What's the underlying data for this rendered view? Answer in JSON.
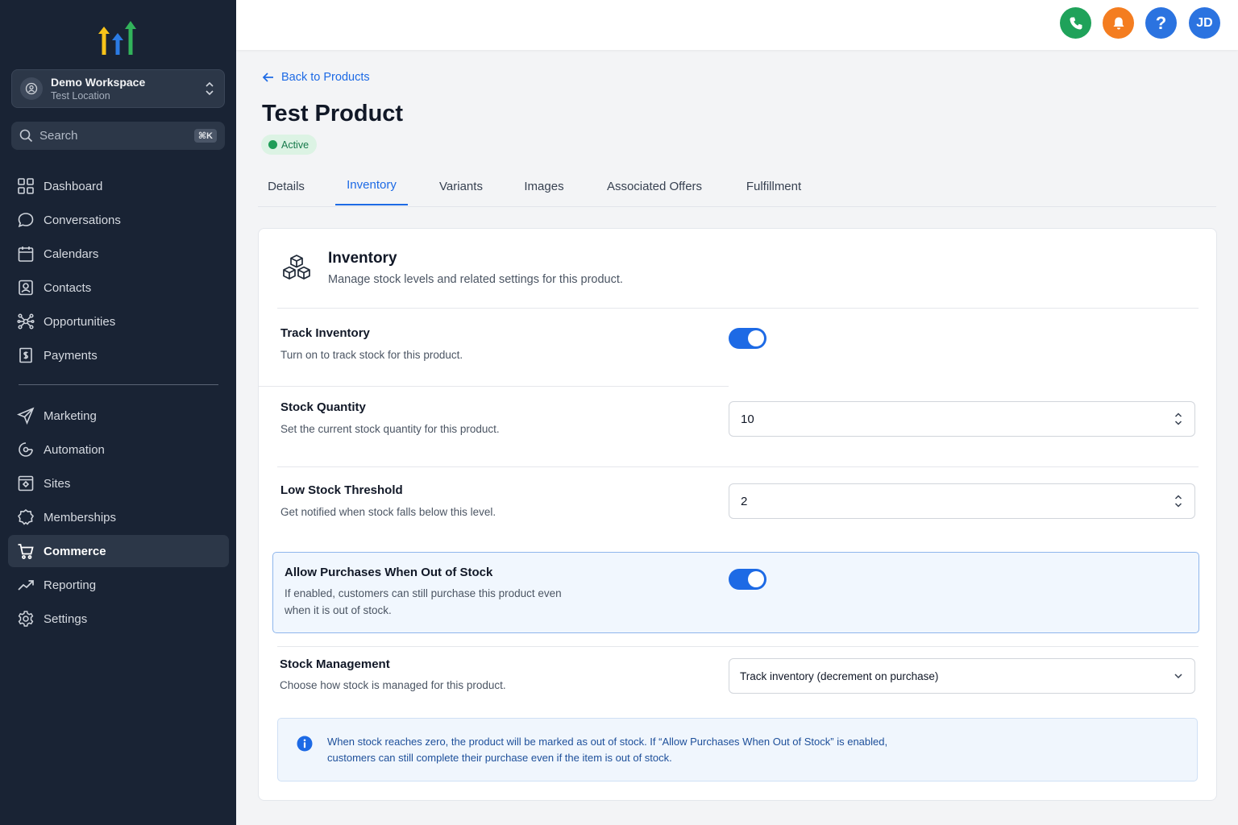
{
  "sidebar": {
    "workspace": {
      "name": "Demo Workspace",
      "location": "Test Location"
    },
    "search": {
      "placeholder": "Search",
      "shortcut": "⌘K"
    },
    "nav_primary": [
      {
        "label": "Dashboard",
        "icon": "grid-icon"
      },
      {
        "label": "Conversations",
        "icon": "chat-bubble-icon"
      },
      {
        "label": "Calendars",
        "icon": "calendar-icon"
      },
      {
        "label": "Contacts",
        "icon": "contact-card-icon"
      },
      {
        "label": "Opportunities",
        "icon": "network-icon"
      },
      {
        "label": "Payments",
        "icon": "receipt-icon"
      }
    ],
    "nav_secondary": [
      {
        "label": "Marketing",
        "icon": "send-icon"
      },
      {
        "label": "Automation",
        "icon": "automation-icon"
      },
      {
        "label": "Sites",
        "icon": "browser-icon"
      },
      {
        "label": "Memberships",
        "icon": "badge-icon"
      },
      {
        "label": "Commerce",
        "icon": "cart-icon",
        "active": true
      },
      {
        "label": "Reporting",
        "icon": "trend-icon"
      },
      {
        "label": "Settings",
        "icon": "gear-icon"
      }
    ]
  },
  "topbar": {
    "buttons": [
      {
        "name": "phone",
        "color": "#1fa25a"
      },
      {
        "name": "notifications",
        "color": "#f47d20"
      },
      {
        "name": "help",
        "color": "#2b73e0"
      },
      {
        "name": "avatar",
        "label": "JD",
        "color": "#2b73e0"
      }
    ]
  },
  "page": {
    "back_link": "Back to Products",
    "title": "Test Product",
    "status": "Active",
    "tabs": [
      "Details",
      "Inventory",
      "Variants",
      "Images",
      "Associated Offers",
      "Fulfillment"
    ],
    "active_tab": "Inventory"
  },
  "inventory": {
    "title": "Inventory",
    "subtitle": "Manage stock levels and related settings for this product.",
    "track": {
      "title": "Track Inventory",
      "desc": "Turn on to track stock for this product.",
      "enabled": true
    },
    "quantity": {
      "title": "Stock Quantity",
      "desc": "Set the current stock quantity for this product.",
      "value": "10"
    },
    "threshold": {
      "title": "Low Stock Threshold",
      "desc": "Get notified when stock falls below this level.",
      "value": "2"
    },
    "allow_oos": {
      "title": "Allow Purchases When Out of Stock",
      "desc_line1": "If enabled, customers can still purchase this product even",
      "desc_line2": "when it is out of stock.",
      "enabled": true
    },
    "management": {
      "title": "Stock Management",
      "desc": "Choose how stock is managed for this product.",
      "value": "Track inventory (decrement on purchase)"
    },
    "info_line1": "When stock reaches zero, the product will be marked as out of stock. If “Allow Purchases When Out of Stock” is enabled,",
    "info_line2": "customers can still complete their purchase even if the item is out of stock."
  },
  "colors": {
    "accent": "#1d6ae5",
    "sidebar": "#192334",
    "success": "#1f9d57"
  }
}
